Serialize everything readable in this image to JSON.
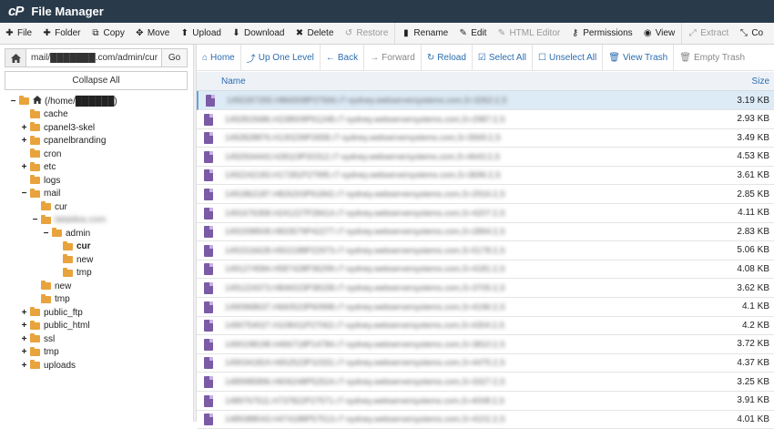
{
  "app": {
    "logo": "cP",
    "title": "File Manager"
  },
  "toolbar": [
    {
      "icon": "plus-icon",
      "glyph": "✚",
      "label": "File",
      "disabled": false
    },
    {
      "icon": "plus-icon",
      "glyph": "✚",
      "label": "Folder",
      "disabled": false
    },
    {
      "icon": "copy-icon",
      "glyph": "⧉",
      "label": "Copy",
      "disabled": false
    },
    {
      "icon": "move-icon",
      "glyph": "✥",
      "label": "Move",
      "disabled": false
    },
    {
      "icon": "upload-icon",
      "glyph": "⬆",
      "label": "Upload",
      "disabled": false
    },
    {
      "icon": "download-icon",
      "glyph": "⬇",
      "label": "Download",
      "disabled": false
    },
    {
      "icon": "delete-icon",
      "glyph": "✖",
      "label": "Delete",
      "disabled": false
    },
    {
      "icon": "restore-icon",
      "glyph": "↺",
      "label": "Restore",
      "disabled": true
    },
    {
      "icon": "file-icon",
      "glyph": "▮",
      "label": "Rename",
      "disabled": false
    },
    {
      "icon": "pencil-icon",
      "glyph": "✎",
      "label": "Edit",
      "disabled": false
    },
    {
      "icon": "html-editor-icon",
      "glyph": "✎",
      "label": "HTML Editor",
      "disabled": true
    },
    {
      "icon": "key-icon",
      "glyph": "⚷",
      "label": "Permissions",
      "disabled": false
    },
    {
      "icon": "eye-icon",
      "glyph": "◉",
      "label": "View",
      "disabled": false
    },
    {
      "icon": "extract-icon",
      "glyph": "⤢",
      "label": "Extract",
      "disabled": true
    },
    {
      "icon": "compress-icon",
      "glyph": "⤡",
      "label": "Co",
      "disabled": false
    }
  ],
  "path": {
    "value": "mail/███████.com/admin/cur",
    "go_label": "Go"
  },
  "collapse_label": "Collapse All",
  "tree": [
    {
      "level": 0,
      "toggle": "−",
      "label": "(/home/██████)",
      "home": true,
      "blur": false
    },
    {
      "level": 1,
      "toggle": "",
      "label": "cache"
    },
    {
      "level": 1,
      "toggle": "+",
      "label": "cpanel3-skel"
    },
    {
      "level": 1,
      "toggle": "+",
      "label": "cpanelbranding"
    },
    {
      "level": 1,
      "toggle": "",
      "label": "cron"
    },
    {
      "level": 1,
      "toggle": "+",
      "label": "etc"
    },
    {
      "level": 1,
      "toggle": "",
      "label": "logs"
    },
    {
      "level": 1,
      "toggle": "−",
      "label": "mail"
    },
    {
      "level": 2,
      "toggle": "",
      "label": "cur"
    },
    {
      "level": 2,
      "toggle": "−",
      "label": "lalaidea.com",
      "blur": true
    },
    {
      "level": 3,
      "toggle": "−",
      "label": "admin"
    },
    {
      "level": 4,
      "toggle": "",
      "label": "cur",
      "bold": true
    },
    {
      "level": 4,
      "toggle": "",
      "label": "new"
    },
    {
      "level": 4,
      "toggle": "",
      "label": "tmp"
    },
    {
      "level": 2,
      "toggle": "",
      "label": "new"
    },
    {
      "level": 2,
      "toggle": "",
      "label": "tmp"
    },
    {
      "level": 1,
      "toggle": "+",
      "label": "public_ftp"
    },
    {
      "level": 1,
      "toggle": "+",
      "label": "public_html"
    },
    {
      "level": 1,
      "toggle": "+",
      "label": "ssl"
    },
    {
      "level": 1,
      "toggle": "+",
      "label": "tmp"
    },
    {
      "level": 1,
      "toggle": "+",
      "label": "uploads"
    }
  ],
  "subtoolbar": [
    {
      "icon": "home-icon",
      "glyph": "⌂",
      "label": "Home",
      "gray": false
    },
    {
      "icon": "level-up-icon",
      "glyph": "⤴",
      "label": "Up One Level",
      "gray": false
    },
    {
      "icon": "arrow-left-icon",
      "glyph": "←",
      "label": "Back",
      "gray": false
    },
    {
      "icon": "arrow-right-icon",
      "glyph": "→",
      "label": "Forward",
      "gray": true
    },
    {
      "icon": "refresh-icon",
      "glyph": "↻",
      "label": "Reload",
      "gray": false
    },
    {
      "icon": "check-square-icon",
      "glyph": "☑",
      "label": "Select All",
      "gray": false
    },
    {
      "icon": "square-icon",
      "glyph": "☐",
      "label": "Unselect All",
      "gray": false
    },
    {
      "icon": "trash-icon",
      "glyph": "🗑",
      "label": "View Trash",
      "gray": false
    },
    {
      "icon": "trash-icon",
      "glyph": "🗑",
      "label": "Empty Trash",
      "gray": true
    }
  ],
  "columns": {
    "name": "Name",
    "size": "Size"
  },
  "files": [
    {
      "name": "1492267265.H866508P27666.r7-sydney.webserversystems.com,S=3262:2,S",
      "size": "3.19 KB",
      "selected": true
    },
    {
      "name": "1492815686.H238509P61248.r7-sydney.webserversystems.com,S=2987:2,S",
      "size": "2.93 KB"
    },
    {
      "name": "1492828876.H130239P2658.r7-sydney.webserversystems.com,S=3569:2,S",
      "size": "3.49 KB"
    },
    {
      "name": "1492934443.H28119P20312.r7-sydney.webserversystems.com,S=4643:2,S",
      "size": "4.53 KB"
    },
    {
      "name": "1492242183.H17281P27995.r7-sydney.webserversystems.com,S=3696:2,S",
      "size": "3.61 KB"
    },
    {
      "name": "1491862187.H826203P61842.r7-sydney.webserversystems.com,S=2916:2,S",
      "size": "2.85 KB"
    },
    {
      "name": "1491676358.H241227P28414.r7-sydney.webserversystems.com,S=4207:2,S",
      "size": "4.11 KB"
    },
    {
      "name": "1491598508.H833579P42277.r7-sydney.webserversystems.com,S=2894:2,S",
      "size": "2.83 KB"
    },
    {
      "name": "1491516628.H502188P22973.r7-sydney.webserversystems.com,S=5178:2,S",
      "size": "5.06 KB"
    },
    {
      "name": "1491274584.H587428P36299.r7-sydney.webserversystems.com,S=4181:2,S",
      "size": "4.08 KB"
    },
    {
      "name": "1491224373.H846023P38158.r7-sydney.webserversystems.com,S=3705:2,S",
      "size": "3.62 KB"
    },
    {
      "name": "1490968637.H660523P60998.r7-sydney.webserversystems.com,S=4196:2,S",
      "size": "4.1 KB"
    },
    {
      "name": "1490754027.H108411P27062.r7-sydney.webserversystems.com,S=4304:2,S",
      "size": "4.2 KB"
    },
    {
      "name": "1490198198.H466718P14784.r7-sydney.webserversystems.com,S=3810:2,S",
      "size": "3.72 KB"
    },
    {
      "name": "1490341824.H652523P10331.r7-sydney.webserversystems.com,S=4475:2,S",
      "size": "4.37 KB"
    },
    {
      "name": "1489985896.H606248P52524.r7-sydney.webserversystems.com,S=3327:2,S",
      "size": "3.25 KB"
    },
    {
      "name": "1489767511.H737822P27571.r7-sydney.webserversystems.com,S=4008:2,S",
      "size": "3.91 KB"
    },
    {
      "name": "1489388043.H474188P57513.r7-sydney.webserversystems.com,S=4101:2,S",
      "size": "4.01 KB"
    }
  ]
}
